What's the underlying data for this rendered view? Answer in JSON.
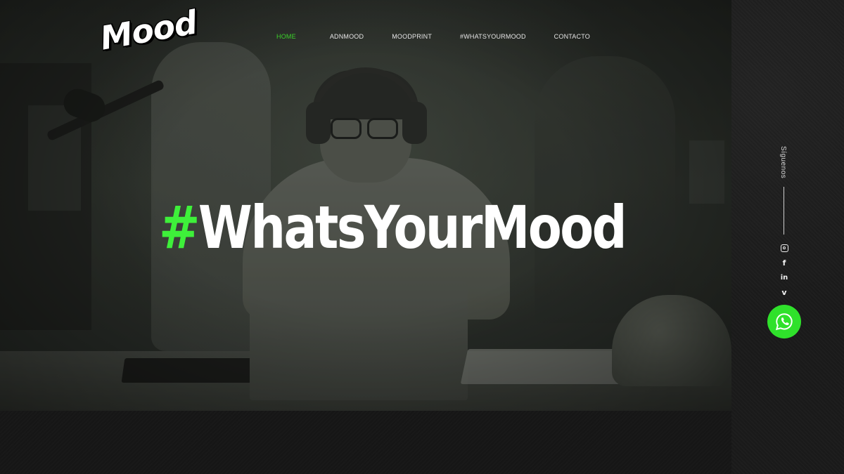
{
  "brand": {
    "logo_text": "Mood",
    "accent_color": "#3ef03a"
  },
  "nav": {
    "items": [
      {
        "label": "HOME",
        "active": true
      },
      {
        "label": "ADNMOOD",
        "active": false
      },
      {
        "label": "MOODPRINT",
        "active": false
      },
      {
        "label": "#WHATSYOURMOOD",
        "active": false
      },
      {
        "label": "CONTACTO",
        "active": false
      }
    ]
  },
  "hero": {
    "hash": "#",
    "title": "WhatsYourMood"
  },
  "social": {
    "label": "Síguenos",
    "icons": [
      "instagram-icon",
      "facebook-icon",
      "linkedin-icon",
      "vimeo-icon"
    ],
    "facebook_glyph": "f",
    "linkedin_glyph": "in",
    "vimeo_glyph": "v",
    "whatsapp_icon": "whatsapp-icon"
  }
}
